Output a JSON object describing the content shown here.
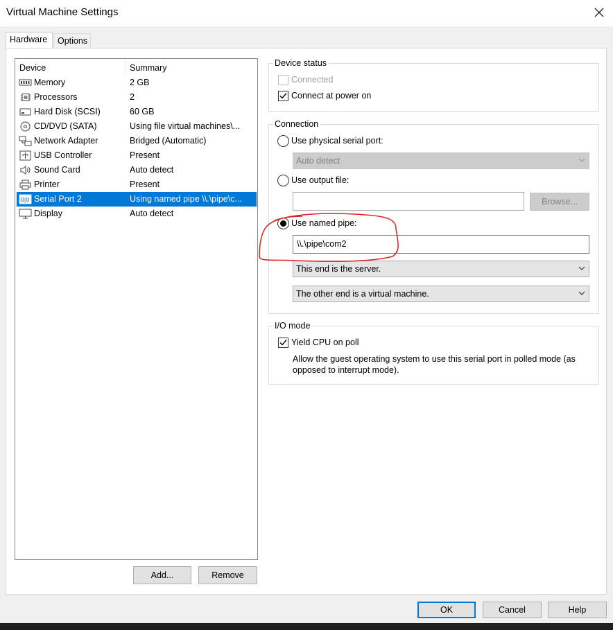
{
  "window": {
    "title": "Virtual Machine Settings"
  },
  "tabs": [
    {
      "label": "Hardware",
      "active": true
    },
    {
      "label": "Options",
      "active": false
    }
  ],
  "device_list": {
    "col_device": "Device",
    "col_summary": "Summary",
    "rows": [
      {
        "device": "Memory",
        "summary": "2 GB",
        "icon": "memory-icon"
      },
      {
        "device": "Processors",
        "summary": "2",
        "icon": "processor-icon"
      },
      {
        "device": "Hard Disk (SCSI)",
        "summary": "60 GB",
        "icon": "hard-disk-icon"
      },
      {
        "device": "CD/DVD (SATA)",
        "summary": "Using file virtual machines\\...",
        "icon": "cd-dvd-icon"
      },
      {
        "device": "Network Adapter",
        "summary": "Bridged (Automatic)",
        "icon": "network-adapter-icon"
      },
      {
        "device": "USB Controller",
        "summary": "Present",
        "icon": "usb-icon"
      },
      {
        "device": "Sound Card",
        "summary": "Auto detect",
        "icon": "speaker-icon"
      },
      {
        "device": "Printer",
        "summary": "Present",
        "icon": "printer-icon"
      },
      {
        "device": "Serial Port 2",
        "summary": "Using named pipe \\\\.\\pipe\\c...",
        "icon": "serial-port-icon",
        "selected": true
      },
      {
        "device": "Display",
        "summary": "Auto detect",
        "icon": "monitor-icon"
      }
    ]
  },
  "list_buttons": {
    "add": "Add...",
    "remove": "Remove"
  },
  "device_status": {
    "title": "Device status",
    "connected_label": "Connected",
    "connected_checked": false,
    "connect_power_label": "Connect at power on",
    "connect_power_checked": true
  },
  "connection": {
    "title": "Connection",
    "physical_label": "Use physical serial port:",
    "physical_value": "Auto detect",
    "output_file_label": "Use output file:",
    "output_file_value": "",
    "browse_label": "Browse...",
    "named_pipe_label": "Use named pipe:",
    "named_pipe_value": "\\\\.\\pipe\\com2",
    "end_value": "This end is the server.",
    "other_end_value": "The other end is a virtual machine.",
    "selected": "named_pipe"
  },
  "io_mode": {
    "title": "I/O mode",
    "yield_label": "Yield CPU on poll",
    "yield_checked": true,
    "description": "Allow the guest operating system to use this serial port in polled mode (as opposed to interrupt mode)."
  },
  "dialog_buttons": {
    "ok": "OK",
    "cancel": "Cancel",
    "help": "Help"
  },
  "colors": {
    "selection": "#0078d7",
    "annotation": "#e0201c"
  }
}
